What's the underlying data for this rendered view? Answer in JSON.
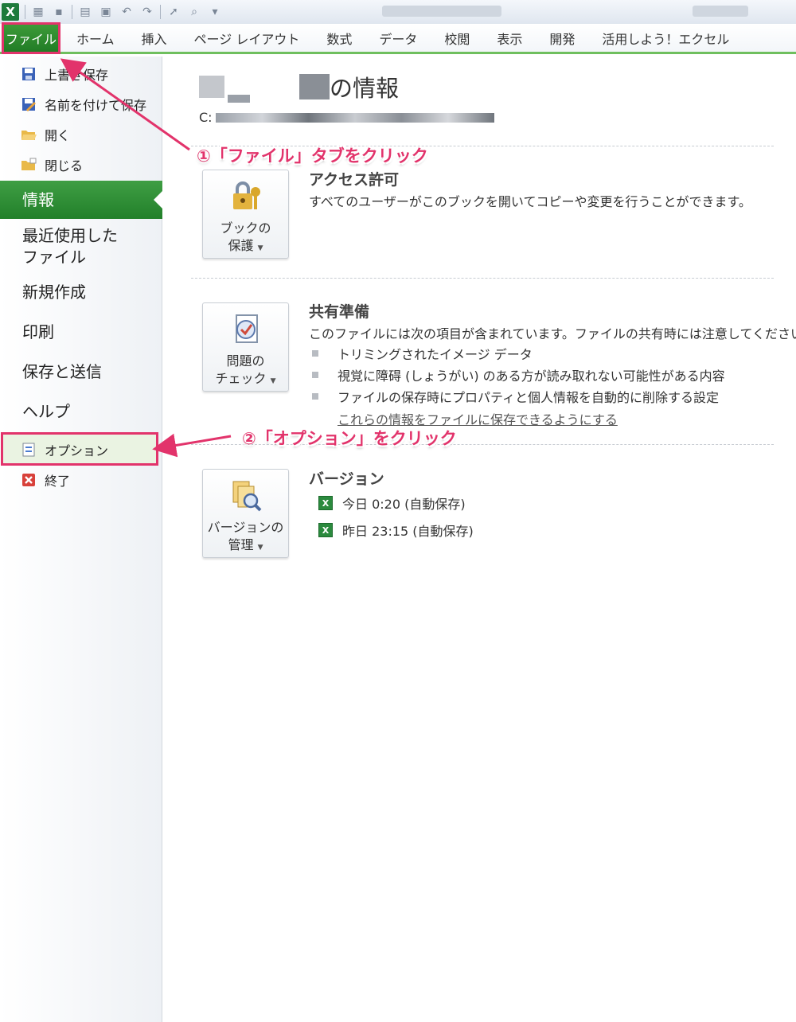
{
  "ribbon": {
    "tabs": [
      "ファイル",
      "ホーム",
      "挿入",
      "ページ レイアウト",
      "数式",
      "データ",
      "校閲",
      "表示",
      "開発",
      "活用しよう！エクセル"
    ]
  },
  "backstage": {
    "commands": [
      {
        "label": "上書き保存",
        "icon": "save-icon"
      },
      {
        "label": "名前を付けて保存",
        "icon": "save-as-icon"
      },
      {
        "label": "開く",
        "icon": "open-folder-icon"
      },
      {
        "label": "閉じる",
        "icon": "close-folder-icon"
      }
    ],
    "nav": {
      "info": "情報",
      "recent_line1": "最近使用した",
      "recent_line2": "ファイル",
      "new": "新規作成",
      "print": "印刷",
      "save_send": "保存と送信",
      "help": "ヘルプ"
    },
    "options": "オプション",
    "exit": "終了"
  },
  "info": {
    "title_suffix": "の情報",
    "path_prefix": "C:",
    "permissions": {
      "button_line1": "ブックの",
      "button_line2": "保護",
      "heading": "アクセス許可",
      "text": "すべてのユーザーがこのブックを開いてコピーや変更を行うことができます。"
    },
    "prepare": {
      "button_line1": "問題の",
      "button_line2": "チェック",
      "heading": "共有準備",
      "text": "このファイルには次の項目が含まれています。ファイルの共有時には注意してください。",
      "items": [
        "トリミングされたイメージ データ",
        "視覚に障碍 (しょうがい) のある方が読み取れない可能性がある内容",
        "ファイルの保存時にプロパティと個人情報を自動的に削除する設定"
      ],
      "link": "これらの情報をファイルに保存できるようにする"
    },
    "versions": {
      "button_line1": "バージョンの",
      "button_line2": "管理",
      "heading": "バージョン",
      "items": [
        "今日 0:20 (自動保存)",
        "昨日 23:15 (自動保存)"
      ]
    }
  },
  "annotations": {
    "step1": "①「ファイル」タブをクリック",
    "step2": "②「オプション」をクリック"
  },
  "colors": {
    "accent_green": "#2f8f35",
    "annotation_pink": "#e2336b"
  }
}
